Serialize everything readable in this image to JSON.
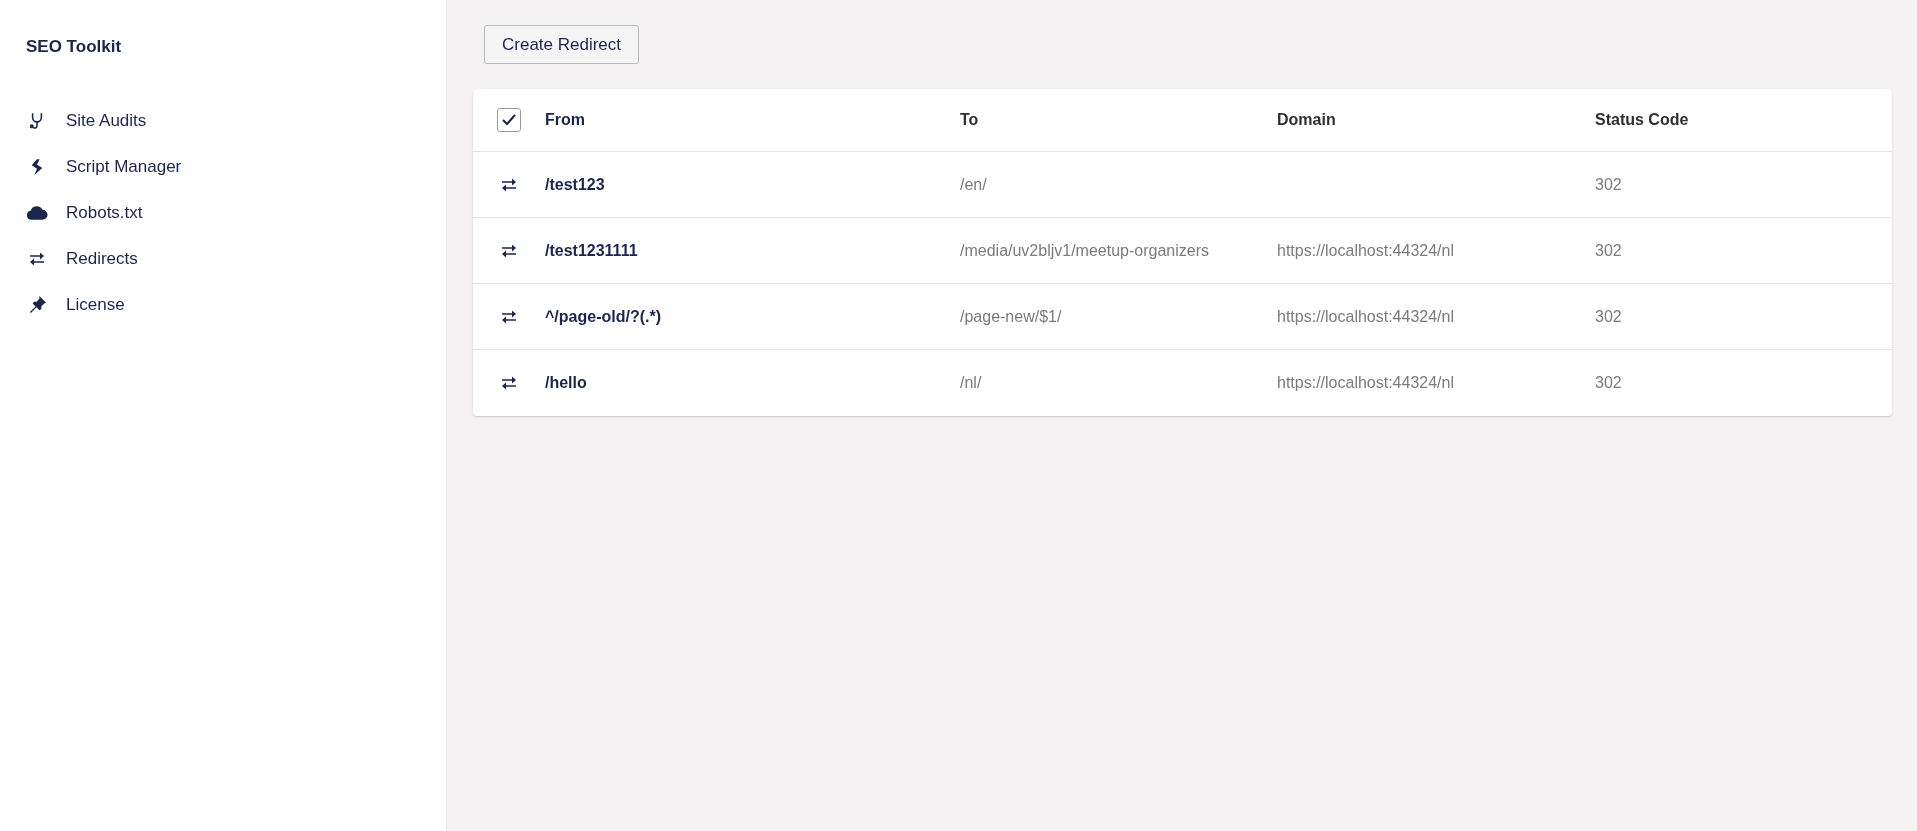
{
  "sidebar": {
    "title": "SEO Toolkit",
    "items": [
      {
        "label": "Site Audits"
      },
      {
        "label": "Script Manager"
      },
      {
        "label": "Robots.txt"
      },
      {
        "label": "Redirects"
      },
      {
        "label": "License"
      }
    ]
  },
  "toolbar": {
    "button": "Create Redirect"
  },
  "table": {
    "select_all_checked": true,
    "columns": [
      "From",
      "To",
      "Domain",
      "Status Code"
    ],
    "rows": [
      {
        "from": "/test123",
        "to": "/en/",
        "status_code": "302"
      },
      {
        "from": "/test1231111",
        "to": "/media/uv2bljv1/meetup-organizers",
        "domain": "https://localhost:44324/nl",
        "status_code": "302"
      },
      {
        "from": "^/page-old/?(.*)",
        "to": "/page-new/$1/",
        "domain": "https://localhost:44324/nl",
        "status_code": "302"
      },
      {
        "from": "/hello",
        "to": "/nl/",
        "domain": "https://localhost:44324/nl",
        "status_code": "302"
      }
    ]
  }
}
